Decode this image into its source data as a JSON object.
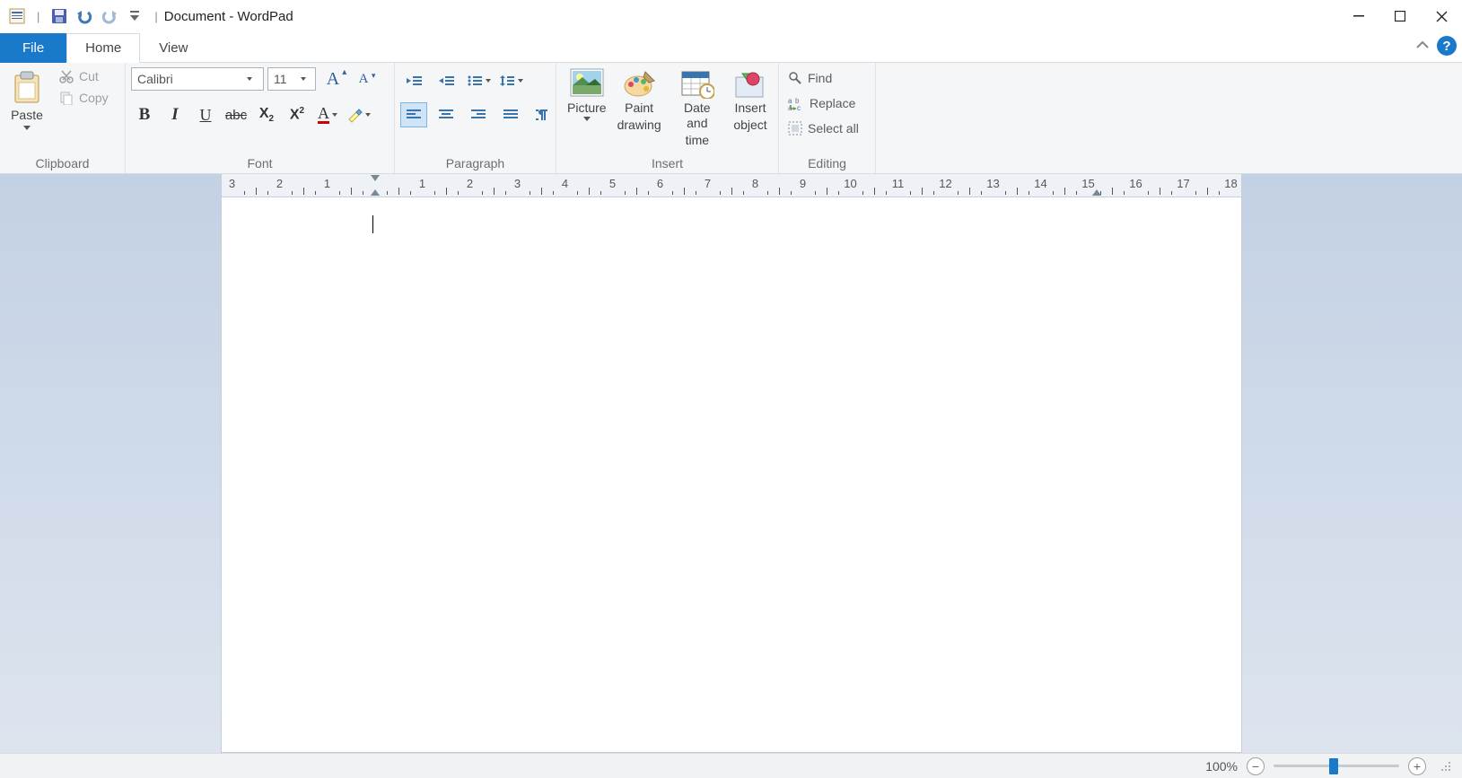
{
  "window": {
    "title": "Document - WordPad"
  },
  "tabs": {
    "file": "File",
    "home": "Home",
    "view": "View"
  },
  "clipboard": {
    "paste": "Paste",
    "cut": "Cut",
    "copy": "Copy",
    "group": "Clipboard"
  },
  "font": {
    "family": "Calibri",
    "size": "11",
    "group": "Font"
  },
  "paragraph": {
    "group": "Paragraph"
  },
  "insert": {
    "picture": "Picture",
    "paint1": "Paint",
    "paint2": "drawing",
    "date1": "Date and",
    "date2": "time",
    "obj1": "Insert",
    "obj2": "object",
    "group": "Insert"
  },
  "editing": {
    "find": "Find",
    "replace": "Replace",
    "selectall": "Select all",
    "group": "Editing"
  },
  "ruler": {
    "left": [
      "3",
      "2",
      "1"
    ],
    "right": [
      "1",
      "2",
      "3",
      "4",
      "5",
      "6",
      "7",
      "8",
      "9",
      "10",
      "11",
      "12",
      "13",
      "14",
      "15",
      "16",
      "17",
      "18"
    ]
  },
  "status": {
    "zoom": "100%"
  }
}
